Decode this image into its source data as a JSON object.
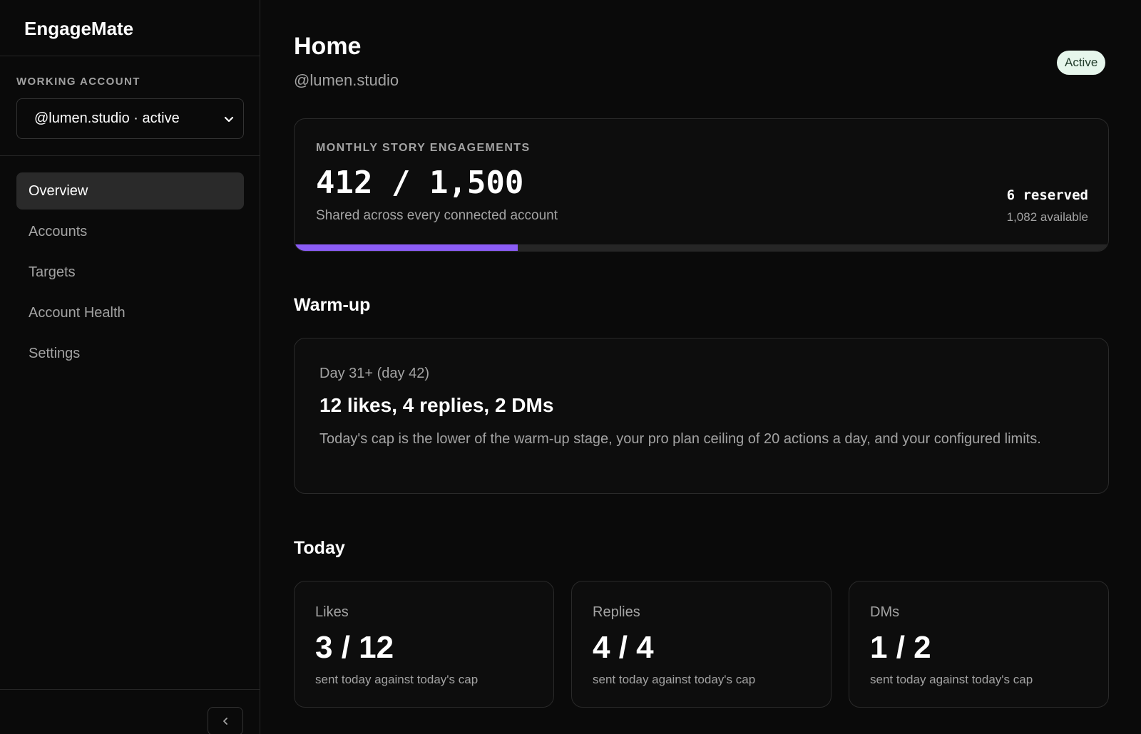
{
  "app": {
    "name": "EngageMate"
  },
  "sidebar": {
    "account_label": "WORKING ACCOUNT",
    "account_select": "@lumen.studio · active",
    "nav": [
      {
        "label": "Overview",
        "active": true
      },
      {
        "label": "Accounts",
        "active": false
      },
      {
        "label": "Targets",
        "active": false
      },
      {
        "label": "Account Health",
        "active": false
      },
      {
        "label": "Settings",
        "active": false
      }
    ]
  },
  "header": {
    "title": "Home",
    "handle": "@lumen.studio",
    "status": "Active"
  },
  "usage": {
    "label": "MONTHLY STORY ENGAGEMENTS",
    "value_text": "412 / 1,500",
    "used": 412,
    "total": 1500,
    "note": "Shared across every connected account",
    "reserved": "6 reserved",
    "available": "1,082 available"
  },
  "warmup": {
    "title": "Warm-up",
    "stage": "Day 31+ (day 42)",
    "headline": "12 likes, 4 replies, 2 DMs",
    "description": "Today's cap is the lower of the warm-up stage, your pro plan ceiling of 20 actions a day, and your configured limits."
  },
  "today": {
    "title": "Today",
    "stats": [
      {
        "label": "Likes",
        "value": "3 / 12",
        "note": "sent today against today's cap"
      },
      {
        "label": "Replies",
        "value": "4 / 4",
        "note": "sent today against today's cap"
      },
      {
        "label": "DMs",
        "value": "1 / 2",
        "note": "sent today against today's cap"
      }
    ]
  },
  "colors": {
    "background": "#0a0a0a",
    "accent": "#8b5cf6",
    "badge_bg": "#e6f6ec"
  },
  "icons": {
    "select_chevron": "chevron-down-icon",
    "collapse": "chevron-left-icon"
  }
}
